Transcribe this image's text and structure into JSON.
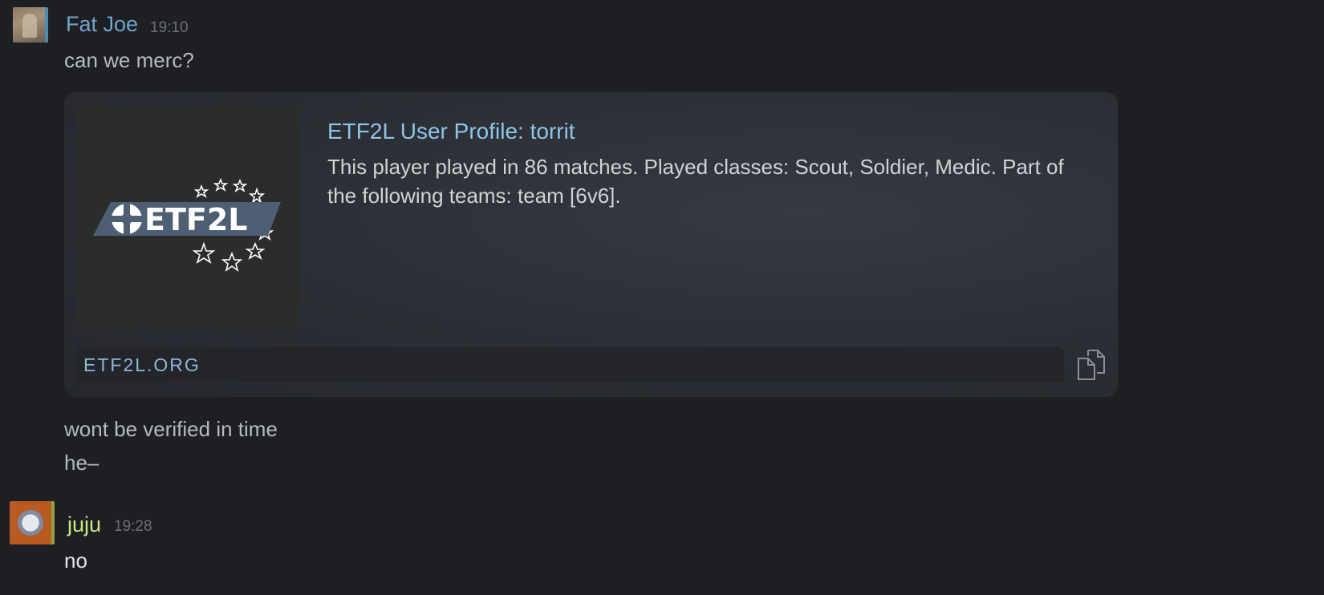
{
  "messages": [
    {
      "author": "Fat Joe",
      "time": "19:10",
      "lines": [
        "can we merc?",
        "wont be verified in time",
        "he–"
      ],
      "embed": {
        "logo_text": "ETF2L",
        "title": "ETF2L User Profile: torrit",
        "description": "This player played in 86 matches. Played classes: Scout, Soldier, Medic. Part of the following teams: team [6v6].",
        "domain": "ETF2L.ORG",
        "copy_icon": "copy-icon"
      }
    },
    {
      "author": "juju",
      "time": "19:28",
      "lines": [
        "no"
      ]
    }
  ],
  "colors": {
    "background": "#1e1f23",
    "fatjoe_name": "#6fa5c9",
    "juju_name": "#cfe57d",
    "embed_title": "#8cc6e6"
  }
}
